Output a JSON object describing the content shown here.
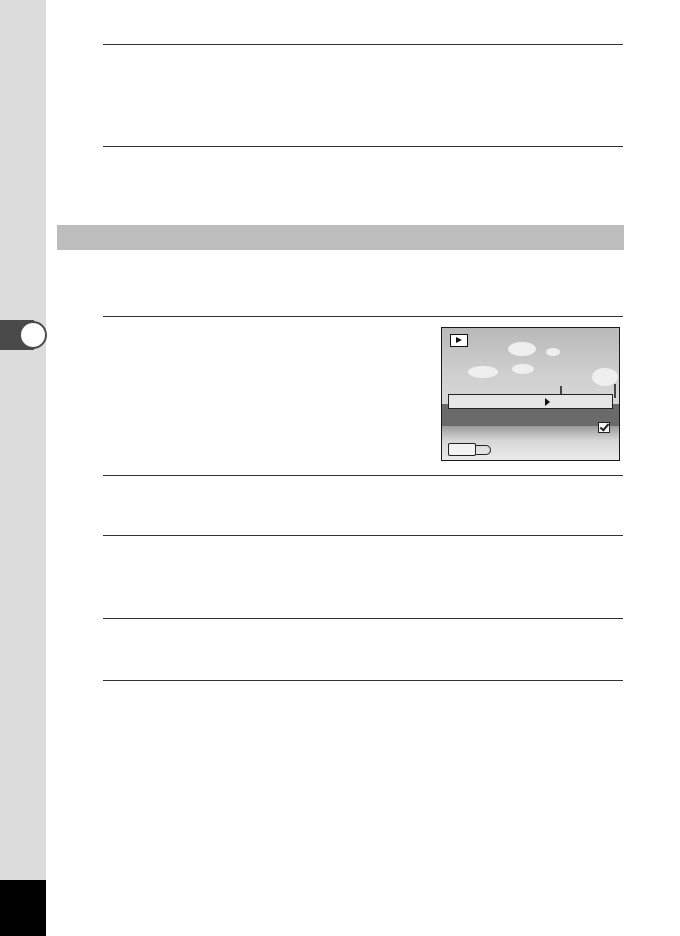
{
  "page": {
    "side_tab_color": "#dcdcdc",
    "section_band_color": "#bdbdbd",
    "footer_block_color": "#000000"
  },
  "camera_screen": {
    "mode_icon": "playback-icon",
    "menu_arrow_icon": "right-triangle-icon",
    "check_icon": "checkbox-checked-icon",
    "back_icon": "return-arrow-icon"
  }
}
